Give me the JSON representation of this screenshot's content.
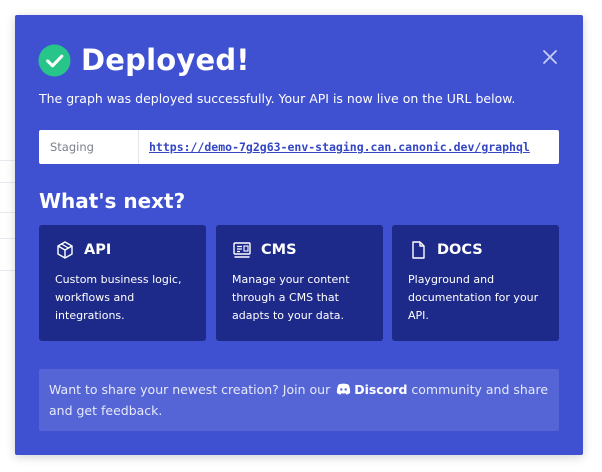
{
  "modal": {
    "title": "Deployed!",
    "subtitle": "The graph was deployed successfully. Your API is now live on the URL below.",
    "icons": {
      "status": "check-circle-icon",
      "close": "close-icon"
    },
    "colors": {
      "modal_bg": "#3f51d0",
      "card_bg": "#1e2a8a",
      "success": "#27c58a",
      "share_bg": "#5565d6"
    }
  },
  "url_box": {
    "label": "Staging",
    "url": "https://demo-7g2g63-env-staging.can.canonic.dev/graphql"
  },
  "next": {
    "heading": "What's next?",
    "cards": [
      {
        "title": "API",
        "icon": "cube-icon",
        "description": "Custom business logic, workflows and integrations."
      },
      {
        "title": "CMS",
        "icon": "cms-icon",
        "description": "Manage your content through a CMS that adapts to your data."
      },
      {
        "title": "DOCS",
        "icon": "document-icon",
        "description": "Playground and documentation for your API."
      }
    ]
  },
  "share": {
    "text_before": "Want to share your newest creation? Join our",
    "link_label": "Discord",
    "link_icon": "discord-icon",
    "text_after": "community and share and get feedback."
  }
}
